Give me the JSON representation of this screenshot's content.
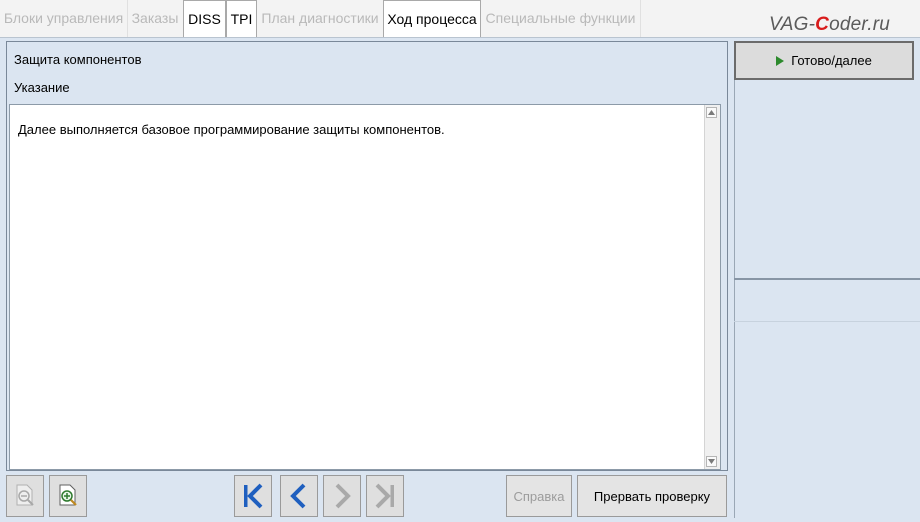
{
  "tabs": [
    {
      "label": "Блоки управления",
      "active": false
    },
    {
      "label": "Заказы",
      "active": false
    },
    {
      "label": "DISS",
      "active": true
    },
    {
      "label": "TPI",
      "active": true
    },
    {
      "label": "План диагностики",
      "active": false
    },
    {
      "label": "Ход процесса",
      "active": true
    },
    {
      "label": "Специальные функции",
      "active": false
    }
  ],
  "watermark": {
    "prefix": "VAG-",
    "highlight": "C",
    "suffix": "oder.ru"
  },
  "header": {
    "title": "Защита компонентов",
    "subtitle": "Указание"
  },
  "content": {
    "text": "Далее выполняется базовое программирование защиты компонентов."
  },
  "actions": {
    "ready_label": "Готово/далее"
  },
  "footer": {
    "help_label": "Справка",
    "abort_label": "Прервать проверку"
  },
  "colors": {
    "accent": "#1f5fbf",
    "play": "#2d8a2d",
    "logo_c": "#d91c1c"
  }
}
